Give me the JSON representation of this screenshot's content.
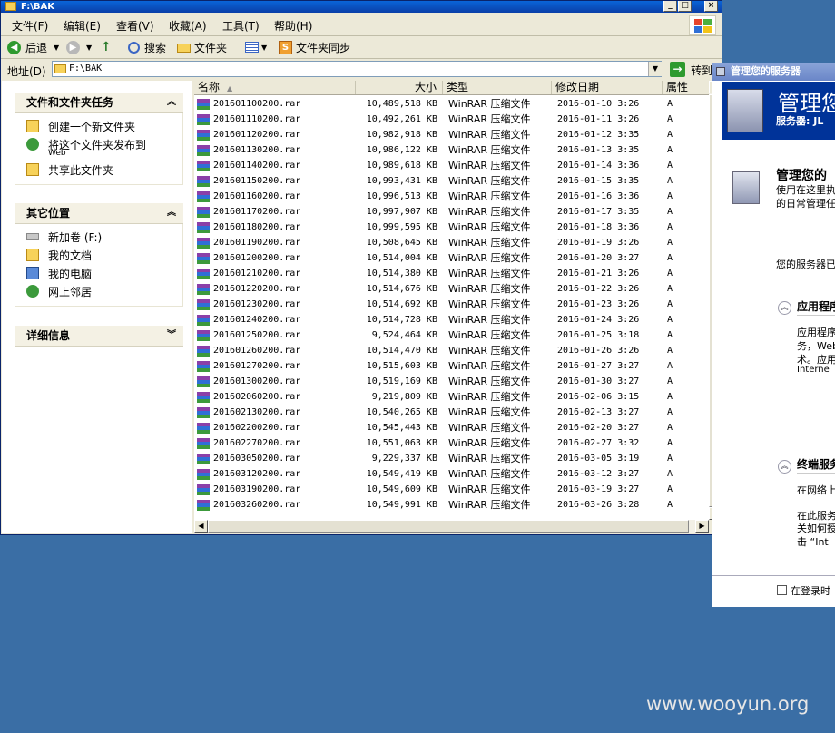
{
  "explorer": {
    "title": "F:\\BAK",
    "menu": [
      "文件(F)",
      "编辑(E)",
      "查看(V)",
      "收藏(A)",
      "工具(T)",
      "帮助(H)"
    ],
    "toolbar": {
      "back": "后退",
      "search": "搜索",
      "folders": "文件夹",
      "sync": "文件夹同步"
    },
    "address": {
      "label": "地址(D)",
      "value": "F:\\BAK",
      "go": "转到"
    },
    "tasks_panel": {
      "title": "文件和文件夹任务",
      "items": [
        "创建一个新文件夹",
        "将这个文件夹发布到",
        "共享此文件夹"
      ],
      "publish_sub": "Web"
    },
    "places_panel": {
      "title": "其它位置",
      "items": [
        "新加卷 (F:)",
        "我的文档",
        "我的电脑",
        "网上邻居"
      ]
    },
    "details_panel": {
      "title": "详细信息"
    },
    "columns": {
      "name": "名称",
      "size": "大小",
      "type": "类型",
      "date": "修改日期",
      "attr": "属性"
    },
    "files": [
      {
        "name": "201601100200.rar",
        "size": "10,489,518 KB",
        "type": "WinRAR 压缩文件",
        "date": "2016-01-10 3:26",
        "attr": "A"
      },
      {
        "name": "201601110200.rar",
        "size": "10,492,261 KB",
        "type": "WinRAR 压缩文件",
        "date": "2016-01-11 3:26",
        "attr": "A"
      },
      {
        "name": "201601120200.rar",
        "size": "10,982,918 KB",
        "type": "WinRAR 压缩文件",
        "date": "2016-01-12 3:35",
        "attr": "A"
      },
      {
        "name": "201601130200.rar",
        "size": "10,986,122 KB",
        "type": "WinRAR 压缩文件",
        "date": "2016-01-13 3:35",
        "attr": "A"
      },
      {
        "name": "201601140200.rar",
        "size": "10,989,618 KB",
        "type": "WinRAR 压缩文件",
        "date": "2016-01-14 3:36",
        "attr": "A"
      },
      {
        "name": "201601150200.rar",
        "size": "10,993,431 KB",
        "type": "WinRAR 压缩文件",
        "date": "2016-01-15 3:35",
        "attr": "A"
      },
      {
        "name": "201601160200.rar",
        "size": "10,996,513 KB",
        "type": "WinRAR 压缩文件",
        "date": "2016-01-16 3:36",
        "attr": "A"
      },
      {
        "name": "201601170200.rar",
        "size": "10,997,907 KB",
        "type": "WinRAR 压缩文件",
        "date": "2016-01-17 3:35",
        "attr": "A"
      },
      {
        "name": "201601180200.rar",
        "size": "10,999,595 KB",
        "type": "WinRAR 压缩文件",
        "date": "2016-01-18 3:36",
        "attr": "A"
      },
      {
        "name": "201601190200.rar",
        "size": "10,508,645 KB",
        "type": "WinRAR 压缩文件",
        "date": "2016-01-19 3:26",
        "attr": "A"
      },
      {
        "name": "201601200200.rar",
        "size": "10,514,004 KB",
        "type": "WinRAR 压缩文件",
        "date": "2016-01-20 3:27",
        "attr": "A"
      },
      {
        "name": "201601210200.rar",
        "size": "10,514,380 KB",
        "type": "WinRAR 压缩文件",
        "date": "2016-01-21 3:26",
        "attr": "A"
      },
      {
        "name": "201601220200.rar",
        "size": "10,514,676 KB",
        "type": "WinRAR 压缩文件",
        "date": "2016-01-22 3:26",
        "attr": "A"
      },
      {
        "name": "201601230200.rar",
        "size": "10,514,692 KB",
        "type": "WinRAR 压缩文件",
        "date": "2016-01-23 3:26",
        "attr": "A"
      },
      {
        "name": "201601240200.rar",
        "size": "10,514,728 KB",
        "type": "WinRAR 压缩文件",
        "date": "2016-01-24 3:26",
        "attr": "A"
      },
      {
        "name": "201601250200.rar",
        "size": "9,524,464 KB",
        "type": "WinRAR 压缩文件",
        "date": "2016-01-25 3:18",
        "attr": "A"
      },
      {
        "name": "201601260200.rar",
        "size": "10,514,470 KB",
        "type": "WinRAR 压缩文件",
        "date": "2016-01-26 3:26",
        "attr": "A"
      },
      {
        "name": "201601270200.rar",
        "size": "10,515,603 KB",
        "type": "WinRAR 压缩文件",
        "date": "2016-01-27 3:27",
        "attr": "A"
      },
      {
        "name": "201601300200.rar",
        "size": "10,519,169 KB",
        "type": "WinRAR 压缩文件",
        "date": "2016-01-30 3:27",
        "attr": "A"
      },
      {
        "name": "201602060200.rar",
        "size": "9,219,809 KB",
        "type": "WinRAR 压缩文件",
        "date": "2016-02-06 3:15",
        "attr": "A"
      },
      {
        "name": "201602130200.rar",
        "size": "10,540,265 KB",
        "type": "WinRAR 压缩文件",
        "date": "2016-02-13 3:27",
        "attr": "A"
      },
      {
        "name": "201602200200.rar",
        "size": "10,545,443 KB",
        "type": "WinRAR 压缩文件",
        "date": "2016-02-20 3:27",
        "attr": "A"
      },
      {
        "name": "201602270200.rar",
        "size": "10,551,063 KB",
        "type": "WinRAR 压缩文件",
        "date": "2016-02-27 3:32",
        "attr": "A"
      },
      {
        "name": "201603050200.rar",
        "size": "9,229,337 KB",
        "type": "WinRAR 压缩文件",
        "date": "2016-03-05 3:19",
        "attr": "A"
      },
      {
        "name": "201603120200.rar",
        "size": "10,549,419 KB",
        "type": "WinRAR 压缩文件",
        "date": "2016-03-12 3:27",
        "attr": "A"
      },
      {
        "name": "201603190200.rar",
        "size": "10,549,609 KB",
        "type": "WinRAR 压缩文件",
        "date": "2016-03-19 3:27",
        "attr": "A"
      },
      {
        "name": "201603260200.rar",
        "size": "10,549,991 KB",
        "type": "WinRAR 压缩文件",
        "date": "2016-03-26 3:28",
        "attr": "A"
      }
    ]
  },
  "server_window": {
    "title": "管理您的服务器",
    "header_title": "管理您",
    "server_label": "服务器: JL",
    "intro_title": "管理您的",
    "intro_line1": "使用在这里执",
    "intro_line2": "的日常管理任",
    "status_line": "您的服务器已",
    "section1": "应用程序",
    "section1_lines": [
      "应用程序",
      "务，Web",
      "术。应用",
      "Interne"
    ],
    "section2": "终端服务",
    "section2_lines": [
      "在网络上",
      "在此服务",
      "关如何授",
      "击 “Int"
    ],
    "checkbox_label": "在登录时"
  },
  "watermark": "www.wooyun.org",
  "colors": {
    "titlebar": "#0a4fc8",
    "desktop": "#3a6ea5",
    "server_banner": "#003399"
  }
}
